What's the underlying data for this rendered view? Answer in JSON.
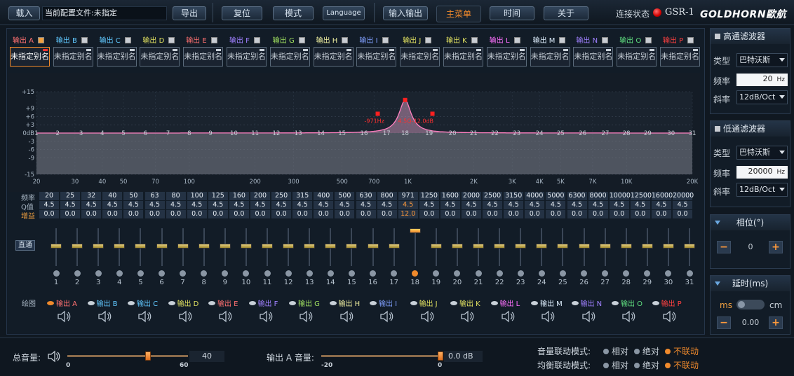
{
  "topbar": {
    "load": "载入",
    "current_file": "当前配置文件:未指定",
    "export": "导出",
    "reset": "复位",
    "mode": "模式",
    "language": "Language",
    "io": "输入输出",
    "main_menu": "主菜单",
    "time": "时间",
    "about": "关于",
    "connection_status": "连接状态",
    "model": "GSR-1",
    "logo": "GOLDHORN歐航"
  },
  "channels": [
    {
      "label": "输出 A",
      "color": "#ff7070",
      "checked": true
    },
    {
      "label": "输出 B",
      "color": "#60c8ff",
      "checked": false
    },
    {
      "label": "输出 C",
      "color": "#60c8ff",
      "checked": false
    },
    {
      "label": "输出 D",
      "color": "#e0e060",
      "checked": false
    },
    {
      "label": "输出 E",
      "color": "#ff7070",
      "checked": false
    },
    {
      "label": "输出 F",
      "color": "#a080ff",
      "checked": false
    },
    {
      "label": "输出 G",
      "color": "#a0e060",
      "checked": false
    },
    {
      "label": "输出 H",
      "color": "#f0f0a0",
      "checked": false
    },
    {
      "label": "输出 I",
      "color": "#80a0ff",
      "checked": false
    },
    {
      "label": "输出 J",
      "color": "#e0e060",
      "checked": false
    },
    {
      "label": "输出 K",
      "color": "#e0e060",
      "checked": false
    },
    {
      "label": "输出 L",
      "color": "#ff70ff",
      "checked": false
    },
    {
      "label": "输出 M",
      "color": "#e0f0ff",
      "checked": false
    },
    {
      "label": "输出 N",
      "color": "#a080ff",
      "checked": false
    },
    {
      "label": "输出 O",
      "color": "#60e080",
      "checked": false
    },
    {
      "label": "输出 P",
      "color": "#ff4040",
      "checked": false
    }
  ],
  "alias_default": "未指定别名",
  "graph": {
    "y_ticks": [
      "+15",
      "+9",
      "+6",
      "+3",
      "0dB",
      "-3",
      "-6",
      "-9",
      "-15"
    ],
    "x_ticks": [
      "20",
      "30",
      "40",
      "50",
      "70",
      "100",
      "200",
      "300",
      "500",
      "700",
      "1K",
      "2K",
      "3K",
      "4K",
      "5K",
      "7K",
      "10K",
      "20K"
    ],
    "band_numbers": [
      "1",
      "2",
      "3",
      "4",
      "5",
      "6",
      "7",
      "8",
      "9",
      "10",
      "11",
      "12",
      "13",
      "14",
      "15",
      "16",
      "17",
      "18",
      "19",
      "20",
      "21",
      "22",
      "23",
      "24",
      "25",
      "26",
      "27",
      "28",
      "29",
      "30",
      "31"
    ],
    "peak_left_label": "-971Hz",
    "peak_right_label": "4.5Q-12.0dB"
  },
  "table": {
    "row_labels": [
      "频率",
      "Q值",
      "增益"
    ],
    "freqs": [
      "20",
      "25",
      "32",
      "40",
      "50",
      "63",
      "80",
      "100",
      "125",
      "160",
      "200",
      "250",
      "315",
      "400",
      "500",
      "630",
      "800",
      "971",
      "1250",
      "1600",
      "2000",
      "2500",
      "3150",
      "4000",
      "5000",
      "6300",
      "8000",
      "10000",
      "12500",
      "16000",
      "20000"
    ],
    "q": [
      "4.5",
      "4.5",
      "4.5",
      "4.5",
      "4.5",
      "4.5",
      "4.5",
      "4.5",
      "4.5",
      "4.5",
      "4.5",
      "4.5",
      "4.5",
      "4.5",
      "4.5",
      "4.5",
      "4.5",
      "4.5",
      "4.5",
      "4.5",
      "4.5",
      "4.5",
      "4.5",
      "4.5",
      "4.5",
      "4.5",
      "4.5",
      "4.5",
      "4.5",
      "4.5",
      "4.5"
    ],
    "gain": [
      "0.0",
      "0.0",
      "0.0",
      "0.0",
      "0.0",
      "0.0",
      "0.0",
      "0.0",
      "0.0",
      "0.0",
      "0.0",
      "0.0",
      "0.0",
      "0.0",
      "0.0",
      "0.0",
      "0.0",
      "12.0",
      "0.0",
      "0.0",
      "0.0",
      "0.0",
      "0.0",
      "0.0",
      "0.0",
      "0.0",
      "0.0",
      "0.0",
      "0.0",
      "0.0",
      "0.0"
    ]
  },
  "bypass": "直通",
  "selected_band": 18,
  "draw_label": "绘图",
  "highpass": {
    "title": "高通滤波器",
    "type_label": "类型",
    "type": "巴特沃斯",
    "freq_label": "频率",
    "freq": "20",
    "freq_unit": "Hz",
    "slope_label": "斜率",
    "slope": "12dB/Oct"
  },
  "lowpass": {
    "title": "低通滤波器",
    "type_label": "类型",
    "type": "巴特沃斯",
    "freq_label": "频率",
    "freq": "20000",
    "freq_unit": "Hz",
    "slope_label": "斜率",
    "slope": "12dB/Oct"
  },
  "phase": {
    "title": "相位(°)",
    "minus": "−",
    "plus": "+",
    "value": "0"
  },
  "delay": {
    "title": "延时(ms)",
    "unit_left": "ms",
    "unit_right": "cm",
    "minus": "−",
    "plus": "+",
    "value": "0.00"
  },
  "bottom": {
    "master_label": "总音量:",
    "master_min": "0",
    "master_max": "60",
    "master_value": "40",
    "master_level": 0.667,
    "out_label": "输出 A 音量:",
    "out_min": "-20",
    "out_max": "0",
    "out_value": "0.0 dB",
    "out_level": 1.0,
    "vol_link_label": "音量联动模式:",
    "eq_link_label": "均衡联动模式:",
    "opt_relative": "相对",
    "opt_absolute": "绝对",
    "opt_none": "不联动"
  }
}
